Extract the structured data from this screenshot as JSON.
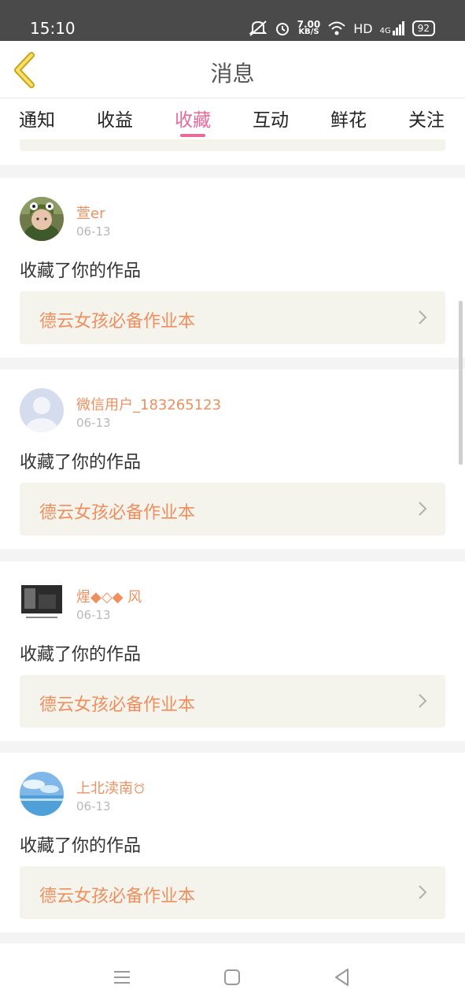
{
  "status_bar": {
    "time": "15:10",
    "net_speed_value": "7.00",
    "net_speed_unit": "KB/S",
    "hd": "HD",
    "signal": "4G",
    "battery": "92"
  },
  "header": {
    "title": "消息"
  },
  "tabs": [
    {
      "label": "通知"
    },
    {
      "label": "收益"
    },
    {
      "label": "收藏",
      "active": true
    },
    {
      "label": "互动"
    },
    {
      "label": "鲜花"
    },
    {
      "label": "关注"
    }
  ],
  "messages": [
    {
      "username": "萱er",
      "date": "06-13",
      "text": "收藏了你的作品",
      "work_title": "德云女孩必备作业本",
      "avatar": "child-photo"
    },
    {
      "username": "微信用户_183265123",
      "date": "06-13",
      "text": "收藏了你的作品",
      "work_title": "德云女孩必备作业本",
      "avatar": "default-user"
    },
    {
      "username": "煋◆◇◆ 风",
      "date": "06-13",
      "text": "收藏了你的作品",
      "work_title": "德云女孩必备作业本",
      "avatar": "dark-photo"
    },
    {
      "username": "上北渎南",
      "date": "06-13",
      "text": "收藏了你的作品",
      "work_title": "德云女孩必备作业本",
      "avatar": "sky-photo"
    }
  ],
  "colors": {
    "accent": "#e8699a",
    "orange": "#ef8f5f",
    "card_bg": "#f4f4ed"
  }
}
